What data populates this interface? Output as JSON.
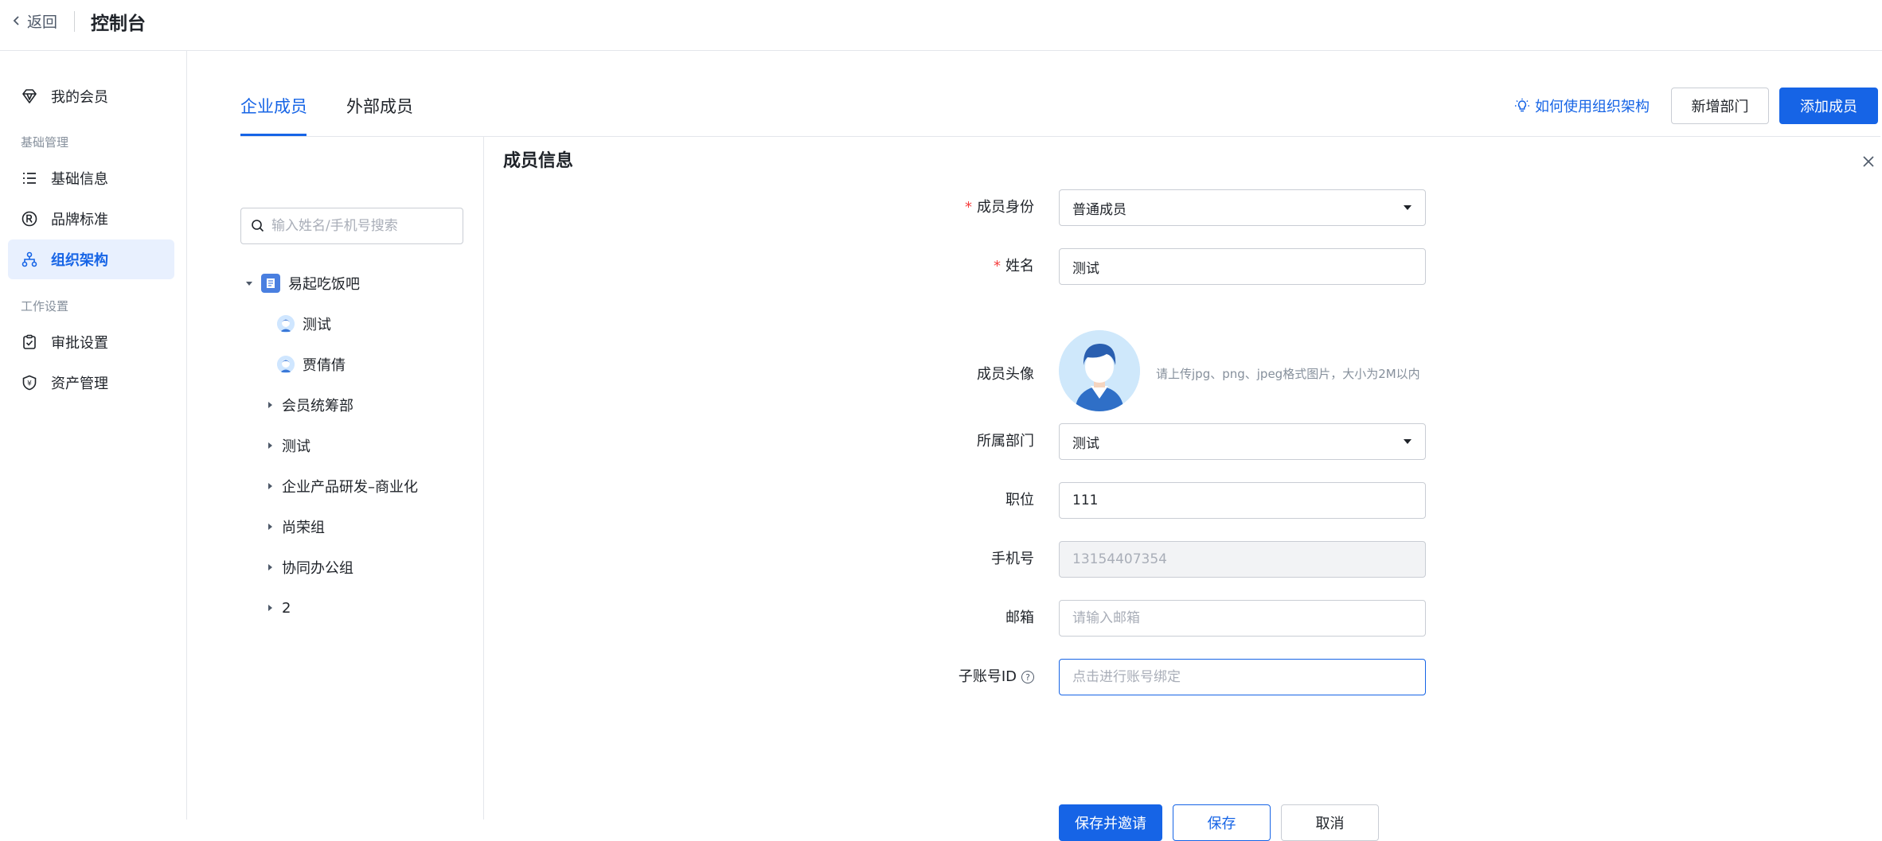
{
  "topbar": {
    "back_label": "返回",
    "title": "控制台"
  },
  "sidebar": {
    "items": [
      {
        "label": "我的会员",
        "icon": "diamond-icon"
      },
      {
        "label": "基础信息",
        "icon": "list-icon"
      },
      {
        "label": "品牌标准",
        "icon": "registered-icon"
      },
      {
        "label": "组织架构",
        "icon": "org-chart-icon",
        "active": true
      },
      {
        "label": "审批设置",
        "icon": "clipboard-check-icon"
      },
      {
        "label": "资产管理",
        "icon": "shield-icon"
      }
    ],
    "groups": [
      "基础管理",
      "工作设置"
    ]
  },
  "tabs": [
    {
      "label": "企业成员",
      "active": true
    },
    {
      "label": "外部成员"
    }
  ],
  "actions": {
    "help_label": "如何使用组织架构",
    "new_dept_label": "新增部门",
    "add_member_label": "添加成员"
  },
  "tree": {
    "search_placeholder": "输入姓名/手机号搜索",
    "root": "易起吃饭吧",
    "members": [
      "测试",
      "贾倩倩"
    ],
    "departments": [
      "会员统筹部",
      "测试",
      "企业产品研发–商业化",
      "尚荣组",
      "协同办公组",
      "2"
    ]
  },
  "form": {
    "title": "成员信息",
    "identity": {
      "label": "成员身份",
      "value": "普通成员"
    },
    "name": {
      "label": "姓名",
      "value": "测试"
    },
    "avatar": {
      "label": "成员头像",
      "hint": "请上传jpg、png、jpeg格式图片，大小为2M以内"
    },
    "dept": {
      "label": "所属部门",
      "value": "测试"
    },
    "position": {
      "label": "职位",
      "value": "111"
    },
    "phone": {
      "label": "手机号",
      "value": "13154407354"
    },
    "email": {
      "label": "邮箱",
      "placeholder": "请输入邮箱"
    },
    "subaccount": {
      "label": "子账号ID",
      "placeholder": "点击进行账号绑定"
    },
    "buttons": {
      "save_invite": "保存并邀请",
      "save": "保存",
      "cancel": "取消"
    }
  },
  "colors": {
    "accent": "#1664e6",
    "required": "#f53f3f"
  }
}
